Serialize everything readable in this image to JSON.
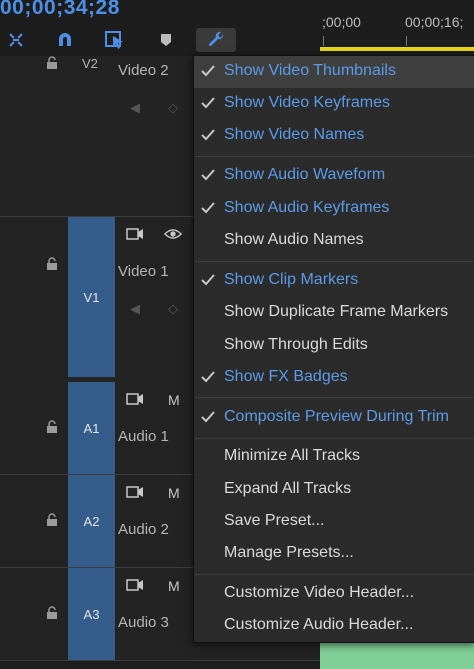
{
  "header": {
    "timecode": "00;00;34;28"
  },
  "ruler": {
    "labels": [
      ";00;00",
      "00;00;16;"
    ]
  },
  "tracks": [
    {
      "id": "V2",
      "name": "Video 2"
    },
    {
      "id": "V1",
      "name": "Video 1"
    },
    {
      "id": "A1",
      "name": "Audio 1",
      "mute": "M"
    },
    {
      "id": "A2",
      "name": "Audio 2",
      "mute": "M"
    },
    {
      "id": "A3",
      "name": "Audio 3",
      "mute": "M"
    }
  ],
  "menu": {
    "items": [
      {
        "label": "Show Video Thumbnails",
        "checked": true
      },
      {
        "label": "Show Video Keyframes",
        "checked": true
      },
      {
        "label": "Show Video Names",
        "checked": true
      },
      {
        "label": "Show Audio Waveform",
        "checked": true
      },
      {
        "label": "Show Audio Keyframes",
        "checked": true
      },
      {
        "label": "Show Audio Names",
        "checked": false
      },
      {
        "label": "Show Clip Markers",
        "checked": true
      },
      {
        "label": "Show Duplicate Frame Markers",
        "checked": false
      },
      {
        "label": "Show Through Edits",
        "checked": false
      },
      {
        "label": "Show FX Badges",
        "checked": true
      },
      {
        "label": "Composite Preview During Trim",
        "checked": true
      },
      {
        "label": "Minimize All Tracks",
        "checked": false
      },
      {
        "label": "Expand All Tracks",
        "checked": false
      },
      {
        "label": "Save Preset...",
        "checked": false
      },
      {
        "label": "Manage Presets...",
        "checked": false
      },
      {
        "label": "Customize Video Header...",
        "checked": false
      },
      {
        "label": "Customize Audio Header...",
        "checked": false
      }
    ]
  },
  "colors": {
    "accent": "#5b9be8",
    "timecode": "#4d8fe6",
    "target": "#355d8c",
    "playhead_bar": "#e7d61a",
    "audio_clip": "#7fcf96"
  }
}
